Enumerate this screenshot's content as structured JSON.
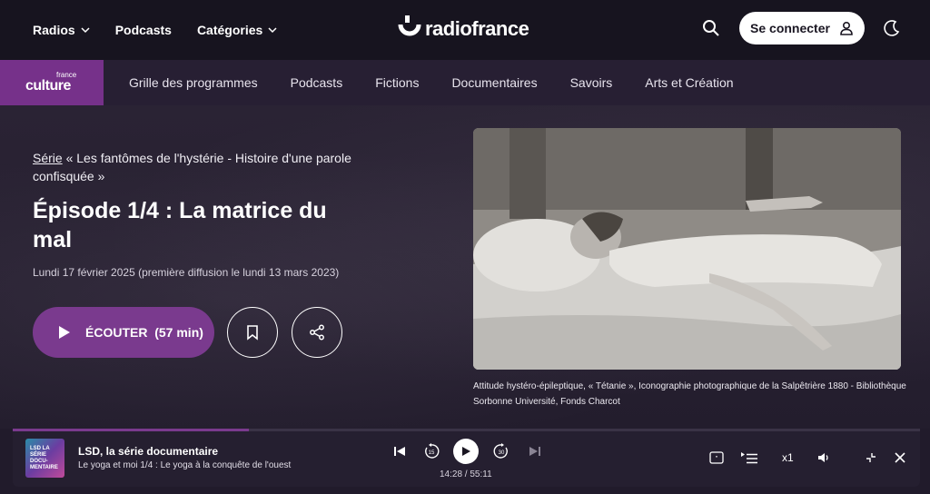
{
  "topbar": {
    "nav": [
      {
        "label": "Radios",
        "has_dropdown": true
      },
      {
        "label": "Podcasts",
        "has_dropdown": false
      },
      {
        "label": "Catégories",
        "has_dropdown": true
      }
    ],
    "logo_text": "radiofrance",
    "login_label": "Se connecter"
  },
  "subnav": {
    "brand_small": "france",
    "brand_big": "culture",
    "items": [
      "Grille des programmes",
      "Podcasts",
      "Fictions",
      "Documentaires",
      "Savoirs",
      "Arts et Création"
    ]
  },
  "episode": {
    "series_link": "Série",
    "series_title": " « Les fantômes de l'hystérie - Histoire d'une parole confisquée »",
    "title": "Épisode 1/4 : La matrice du mal",
    "date": "Lundi 17 février 2025 (première diffusion le lundi 13 mars 2023)",
    "listen_label": "ÉCOUTER",
    "duration": "(57 min)",
    "caption": "Attitude hystéro-épileptique, « Tétanie », Iconographie photographique de la Salpêtrière 1880 - Bibliothèque Sorbonne Université, Fonds Charcot"
  },
  "player": {
    "cover_text": "LSD LA SÉRIE DOCU-MENTAIRE",
    "title": "LSD, la série documentaire",
    "subtitle": "Le yoga et moi 1/4 : Le yoga à la conquête de l'ouest",
    "time": "14:28 / 55:11",
    "skip_back": "15",
    "skip_forward": "30",
    "speed": "x1",
    "progress": 0.26
  },
  "colors": {
    "accent": "#7a3a8e",
    "topbar_bg": "#17141f",
    "page_bg": "#211b2b"
  }
}
